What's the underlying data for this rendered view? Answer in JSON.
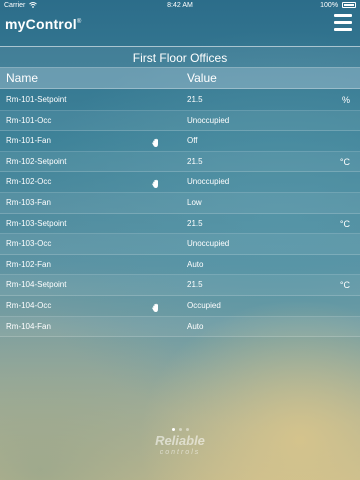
{
  "status_bar": {
    "carrier": "Carrier",
    "time": "8:42 AM",
    "battery": "100%"
  },
  "header": {
    "logo": "myControl",
    "logo_mark": "®"
  },
  "title": "First Floor Offices",
  "columns": {
    "name": "Name",
    "value": "Value"
  },
  "rows": [
    {
      "name": "Rm-101-Setpoint",
      "value": "21.5",
      "unit": "%",
      "hand": ""
    },
    {
      "name": "Rm-101-Occ",
      "value": "Unoccupied",
      "unit": "",
      "hand": ""
    },
    {
      "name": "Rm-101-Fan",
      "value": "Off",
      "unit": "",
      "hand": "hand-icon"
    },
    {
      "name": "Rm-102-Setpoint",
      "value": "21.5",
      "unit": "°C",
      "hand": ""
    },
    {
      "name": "Rm-102-Occ",
      "value": "Unoccupied",
      "unit": "",
      "hand": "hand-icon"
    },
    {
      "name": "Rm-103-Fan",
      "value": "Low",
      "unit": "",
      "hand": ""
    },
    {
      "name": "Rm-103-Setpoint",
      "value": "21.5",
      "unit": "°C",
      "hand": ""
    },
    {
      "name": "Rm-103-Occ",
      "value": "Unoccupied",
      "unit": "",
      "hand": ""
    },
    {
      "name": "Rm-102-Fan",
      "value": "Auto",
      "unit": "",
      "hand": ""
    },
    {
      "name": "Rm-104-Setpoint",
      "value": "21.5",
      "unit": "°C",
      "hand": ""
    },
    {
      "name": "Rm-104-Occ",
      "value": "Occupied",
      "unit": "",
      "hand": "hand-icon"
    },
    {
      "name": "Rm-104-Fan",
      "value": "Auto",
      "unit": "",
      "hand": ""
    }
  ],
  "pager": {
    "pages": 3,
    "current": 1
  },
  "brand": {
    "line1": "Reliable",
    "line2": "controls"
  }
}
